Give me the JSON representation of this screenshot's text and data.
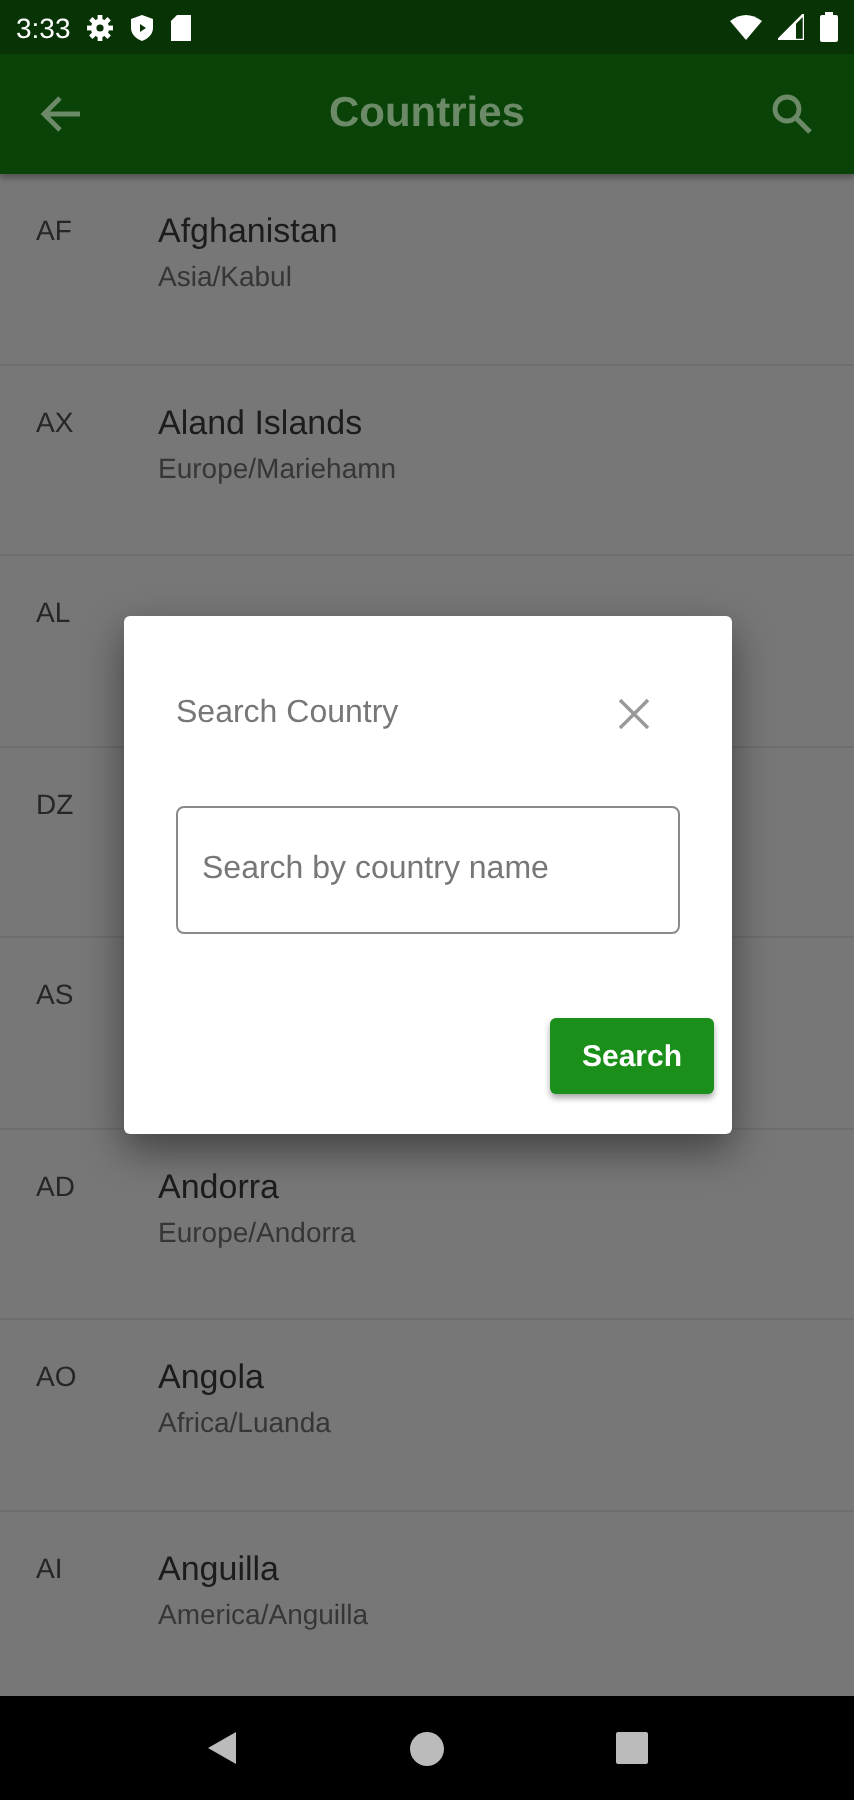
{
  "status_bar": {
    "time": "3:33"
  },
  "app_bar": {
    "title": "Countries"
  },
  "countries": [
    {
      "code": "AF",
      "name": "Afghanistan",
      "timezone": "Asia/Kabul"
    },
    {
      "code": "AX",
      "name": "Aland Islands",
      "timezone": "Europe/Mariehamn"
    },
    {
      "code": "AL"
    },
    {
      "code": "DZ"
    },
    {
      "code": "AS"
    },
    {
      "code": "AD",
      "name": "Andorra",
      "timezone": "Europe/Andorra"
    },
    {
      "code": "AO",
      "name": "Angola",
      "timezone": "Africa/Luanda"
    },
    {
      "code": "AI",
      "name": "Anguilla",
      "timezone": "America/Anguilla"
    }
  ],
  "dialog": {
    "title": "Search Country",
    "search_field": {
      "placeholder": "Search by country name"
    },
    "button": "Search"
  }
}
